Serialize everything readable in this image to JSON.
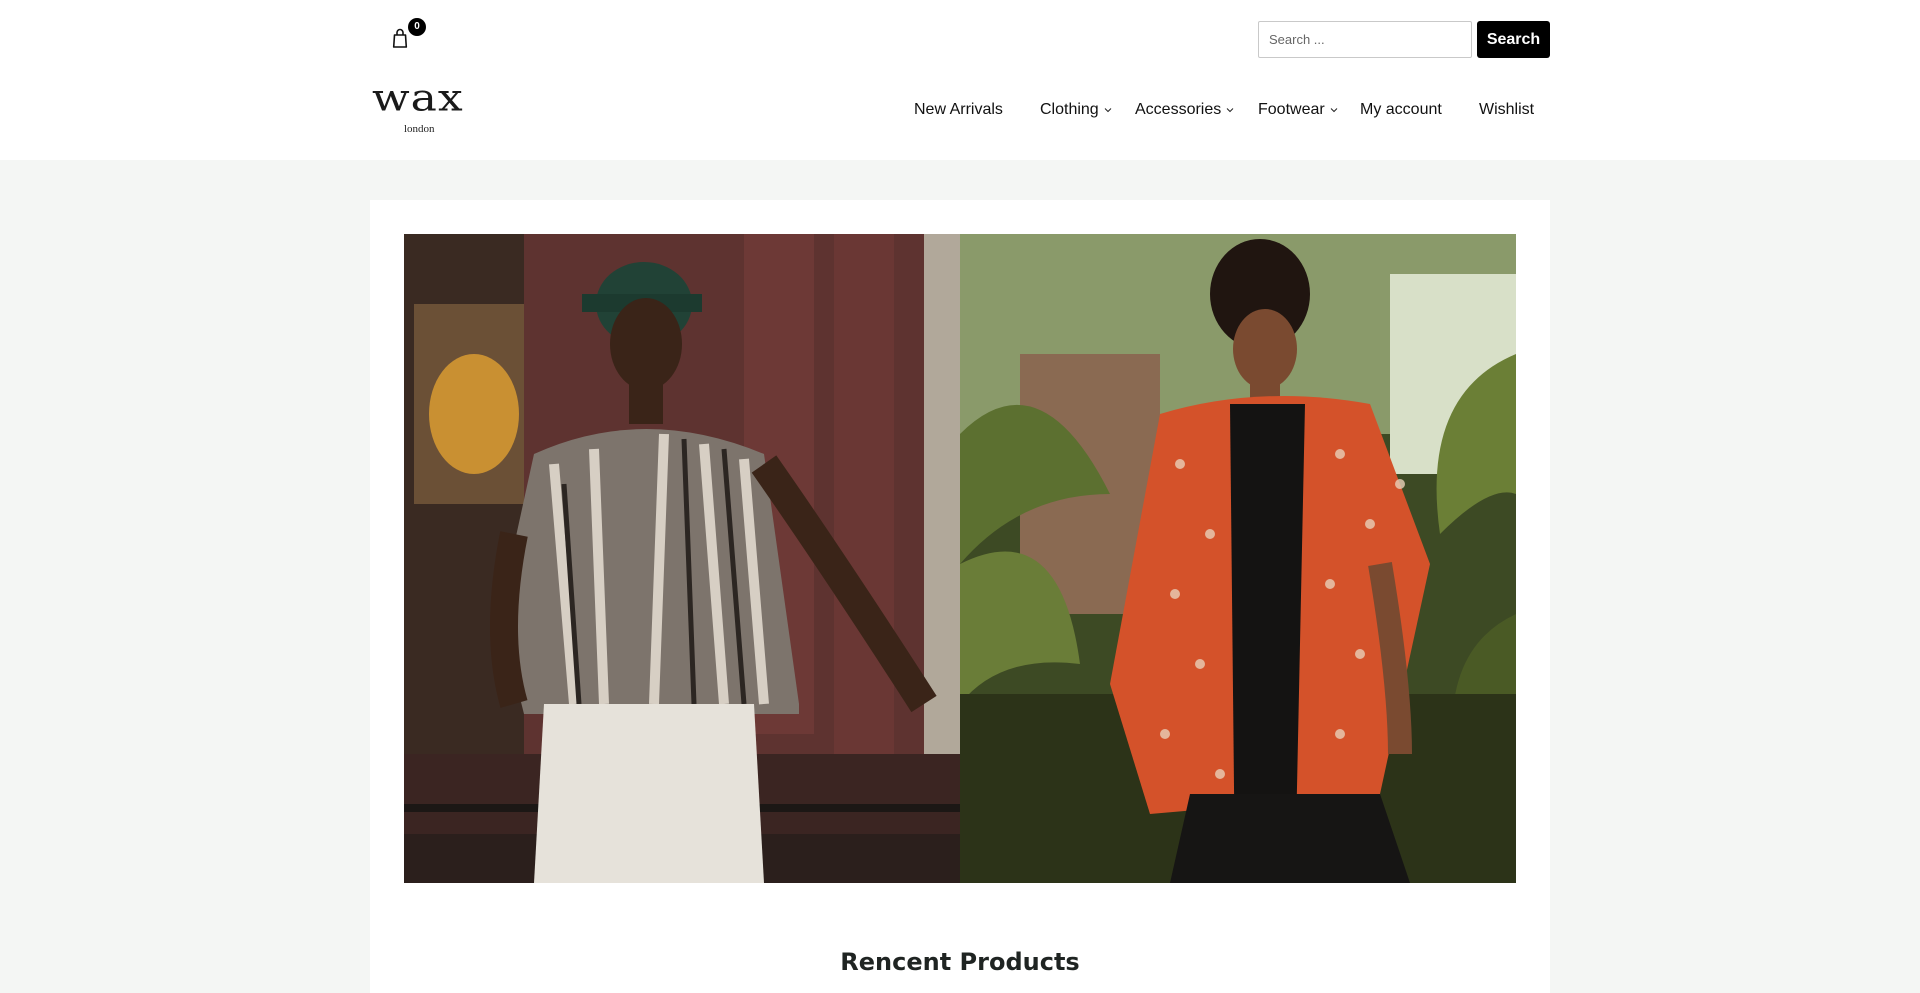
{
  "cart": {
    "count": "0",
    "icon": "shopping-bag-icon"
  },
  "search": {
    "placeholder": "Search ...",
    "value": "",
    "button_label": "Search"
  },
  "logo": {
    "main": "wax",
    "sub": "london"
  },
  "nav": {
    "items": [
      {
        "label": "New Arrivals",
        "has_dropdown": false
      },
      {
        "label": "Clothing",
        "has_dropdown": true
      },
      {
        "label": "Accessories",
        "has_dropdown": true
      },
      {
        "label": "Footwear",
        "has_dropdown": true
      },
      {
        "label": "My account",
        "has_dropdown": false
      },
      {
        "label": "Wishlist",
        "has_dropdown": false
      }
    ]
  },
  "hero": {
    "images": [
      "patterned-shirt-model-photo",
      "orange-shirt-model-photo"
    ]
  },
  "section": {
    "title": "Rencent Products"
  },
  "colors": {
    "background": "#f4f6f4",
    "header": "#ffffff",
    "button": "#000000",
    "text": "#1a1a1a"
  }
}
